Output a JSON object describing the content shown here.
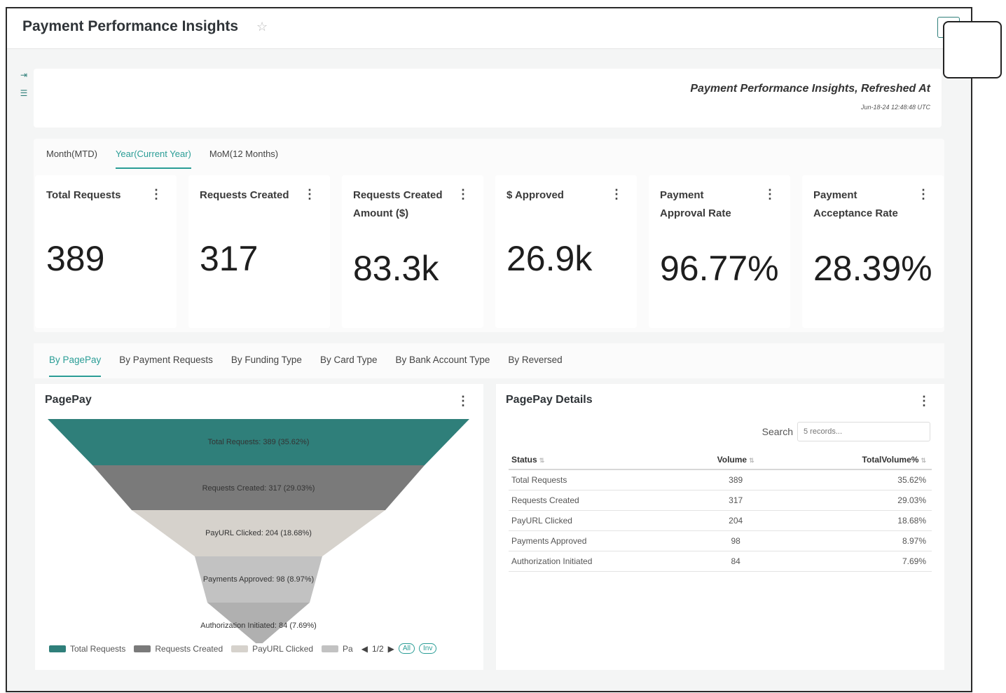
{
  "app": {
    "title": "Payment Performance Insights",
    "star_icon": "star-icon",
    "expand_icon": "expand-icon"
  },
  "sidebar": {
    "icons": [
      "collapse-panel-icon",
      "filter-icon"
    ]
  },
  "refresh": {
    "title": "Payment Performance Insights, Refreshed At",
    "timestamp": "Jun-18-24 12:48:48 UTC"
  },
  "period_tabs": [
    {
      "label": "Month(MTD)",
      "active": false
    },
    {
      "label": "Year(Current Year)",
      "active": true
    },
    {
      "label": "MoM(12 Months)",
      "active": false
    }
  ],
  "kpis": [
    {
      "label": "Total Requests",
      "value": "389"
    },
    {
      "label": "Requests Created",
      "value": "317"
    },
    {
      "label": "Requests Created Amount ($)",
      "value": "83.3k"
    },
    {
      "label": "$ Approved",
      "value": "26.9k"
    },
    {
      "label": "Payment Approval Rate",
      "value": "96.77%"
    },
    {
      "label": "Payment Acceptance Rate",
      "value": "28.39%"
    }
  ],
  "detail_tabs": [
    {
      "label": "By PagePay",
      "active": true
    },
    {
      "label": "By Payment Requests",
      "active": false
    },
    {
      "label": "By Funding Type",
      "active": false
    },
    {
      "label": "By Card Type",
      "active": false
    },
    {
      "label": "By Bank Account Type",
      "active": false
    },
    {
      "label": "By Reversed",
      "active": false
    }
  ],
  "funnel": {
    "title": "PagePay",
    "stages": [
      {
        "label": "Total Requests: 389 (35.62%)",
        "color": "#2f7f7a"
      },
      {
        "label": "Requests Created: 317 (29.03%)",
        "color": "#7a7a7a"
      },
      {
        "label": "PayURL Clicked: 204 (18.68%)",
        "color": "#d6d2cc"
      },
      {
        "label": "Payments Approved: 98 (8.97%)",
        "color": "#c2c2c2"
      },
      {
        "label": "Authorization Initiated: 84 (7.69%)",
        "color": "#b0b0b0"
      }
    ],
    "legend": [
      {
        "label": "Total Requests",
        "color": "#2f7f7a"
      },
      {
        "label": "Requests Created",
        "color": "#7a7a7a"
      },
      {
        "label": "PayURL Clicked",
        "color": "#d6d2cc"
      },
      {
        "label": "Pa",
        "color": "#c2c2c2"
      }
    ],
    "legend_page": "1/2",
    "all_label": "All",
    "inv_label": "Inv"
  },
  "details": {
    "title": "PagePay Details",
    "search_label": "Search",
    "search_placeholder": "5 records...",
    "columns": [
      "Status",
      "Volume",
      "TotalVolume%"
    ],
    "rows": [
      [
        "Total Requests",
        "389",
        "35.62%"
      ],
      [
        "Requests Created",
        "317",
        "29.03%"
      ],
      [
        "PayURL Clicked",
        "204",
        "18.68%"
      ],
      [
        "Payments Approved",
        "98",
        "8.97%"
      ],
      [
        "Authorization Initiated",
        "84",
        "7.69%"
      ]
    ]
  }
}
